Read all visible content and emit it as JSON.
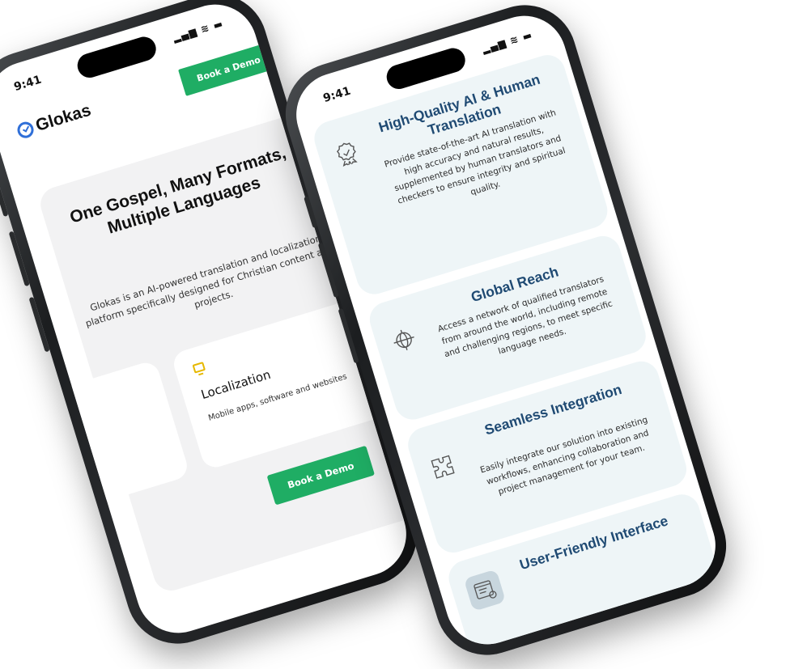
{
  "phone1": {
    "status": {
      "time": "9:41",
      "icons": "▂▄▆ ≋ ▬"
    },
    "brand": "Glokas",
    "header_cta": "Book a Demo",
    "hero": {
      "title": "One Gospel, Many Formats, Multiple Languages",
      "description": "Glokas is an AI-powered translation and localization platform specifically designed for Christian content and projects."
    },
    "feature_card": {
      "icon": "monitor-icon",
      "title": "Localization",
      "description": "Mobile apps,  software and websites"
    },
    "cta": "Book a Demo",
    "colors": {
      "accent": "#1fad64",
      "brand": "#2f6fd8",
      "highlight": "#e6b800"
    }
  },
  "phone2": {
    "status": {
      "time": "9:41",
      "icons": "▂▄▆ ≋ ▬"
    },
    "cards": [
      {
        "icon": "award-ribbon-icon",
        "title": "High-Quality AI & Human Translation",
        "description": "Provide state-of-the-art AI translation with high accuracy and natural results, supplemented by human translators and checkers to ensure integrity and spiritual quality."
      },
      {
        "icon": "globe-icon",
        "title": "Global Reach",
        "description": "Access a network of qualified translators from around the world, including remote and challenging regions, to meet specific language needs."
      },
      {
        "icon": "puzzle-icon",
        "title": "Seamless Integration",
        "description": "Easily integrate our solution into existing workflows, enhancing collaboration and project management for your team."
      },
      {
        "icon": "interface-window-icon",
        "title": "User-Friendly Interface",
        "description": ""
      }
    ],
    "colors": {
      "card_bg": "#eef5f7",
      "title": "#1f4a73"
    }
  }
}
